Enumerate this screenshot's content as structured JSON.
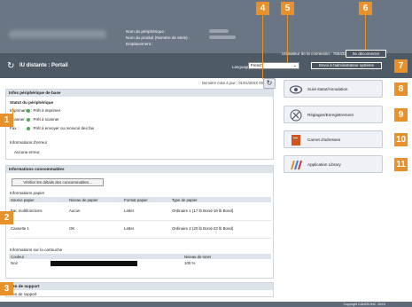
{
  "header": {
    "device_name_label": "Nom du périphérique :",
    "product_name_label": "Nom du produit (Numéro de série) :",
    "location_label": "Emplacement :",
    "portal_title": "IU distante : Portail",
    "user_label": "Utilisateur de la connexion : 765432",
    "logout_label": "Se déconnecter",
    "language_label": "Language",
    "language_value": "French",
    "mail_admin_label": "Envoi à l'administrateur système"
  },
  "last_update": "Dernière mise à jour : 01/01/20XX 00:00:00",
  "basic_info": {
    "title": "Infos périphérique de base",
    "status_title": "Statut du périphérique",
    "rows": [
      {
        "label": "Imprimante :",
        "value": "Prêt à imprimer"
      },
      {
        "label": "Scanner :",
        "value": "Prêt à scanner"
      },
      {
        "label": "Fax :",
        "value": "Prêt à envoyer ou recevoir des fax"
      }
    ],
    "error_title": "Informations d'erreur",
    "error_value": "Aucune erreur."
  },
  "consumables": {
    "title": "Informations consommables",
    "check_button": "Vérifier les détails des consommables...",
    "paper_title": "Informations papier",
    "paper_headers": [
      "Source papier",
      "Niveau de papier",
      "Format papier",
      "Type de papier"
    ],
    "paper_rows": [
      {
        "source": "Bac multifonctions",
        "level": "Aucun",
        "format": "Letter",
        "type": "Ordinaire 1 (17 lb Bond-19 lb Bond)"
      },
      {
        "source": "Cassette 1",
        "level": "OK",
        "format": "Letter",
        "type": "Ordinaire 2 (20 lb Bond-23 lb Bond)"
      }
    ],
    "cartridge_title": "Informations sur la cartouche",
    "cartridge_headers": [
      "Couleur",
      "Niveau de toner"
    ],
    "cartridge_rows": [
      {
        "color": "Noir",
        "level": "100 %",
        "level_fraction": 1.0
      }
    ]
  },
  "support": {
    "title": "Lien de support",
    "link": "Lien de support"
  },
  "side_menu": [
    {
      "label": "Suivi statut/Annulation",
      "icon": "status-monitor-icon"
    },
    {
      "label": "Réglages/Enregistrement",
      "icon": "settings-icon"
    },
    {
      "label": "Carnet d'adresses",
      "icon": "address-book-icon"
    },
    {
      "label": "Application Library",
      "icon": "application-library-icon"
    }
  ],
  "footer": {
    "copyright": "Copyright CANON INC. 20XX"
  },
  "callouts": [
    "1",
    "2",
    "3",
    "4",
    "5",
    "6",
    "7",
    "8",
    "9",
    "10",
    "11"
  ],
  "colors": {
    "header": "#5e6a78",
    "panel_header": "#dde3ea",
    "callout": "#e8902a",
    "status_ok": "#4ab04a"
  }
}
